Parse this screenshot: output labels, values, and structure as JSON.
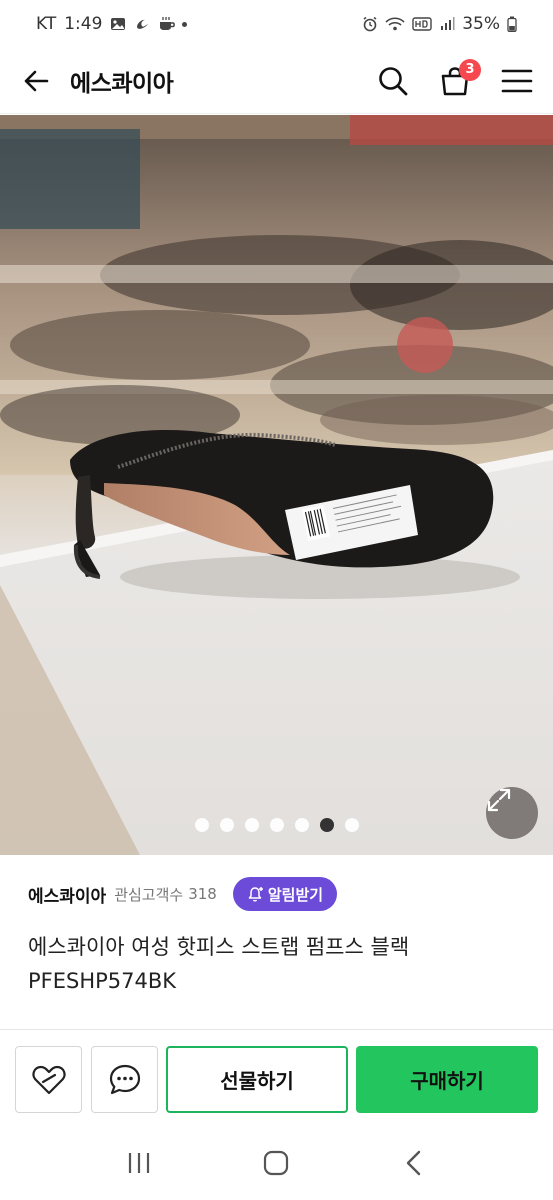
{
  "status_bar": {
    "carrier": "KT",
    "time": "1:49",
    "battery": "35%",
    "left_icons": [
      "image-icon",
      "nike-icon",
      "coffee-icon",
      "dot-icon"
    ],
    "right_icons": [
      "alarm-icon",
      "wifi-icon",
      "hd-icon",
      "signal-icon",
      "battery-icon"
    ]
  },
  "header": {
    "title": "에스콰이아",
    "cart_count": "3"
  },
  "gallery": {
    "image_count": 7,
    "active_index": 5
  },
  "seller": {
    "name": "에스콰이아",
    "followers_label": "관심고객수",
    "followers_count": "318",
    "alarm_button": "알림받기"
  },
  "product": {
    "title": "에스콰이아 여성 핫피스 스트랩 펌프스 블랙 PFESHP574BK"
  },
  "actions": {
    "gift_label": "선물하기",
    "buy_label": "구매하기"
  },
  "colors": {
    "accent_purple": "#6c4bd8",
    "buy_green": "#22c55e",
    "gift_border": "#1cb45c",
    "badge_red": "#f5484f"
  }
}
